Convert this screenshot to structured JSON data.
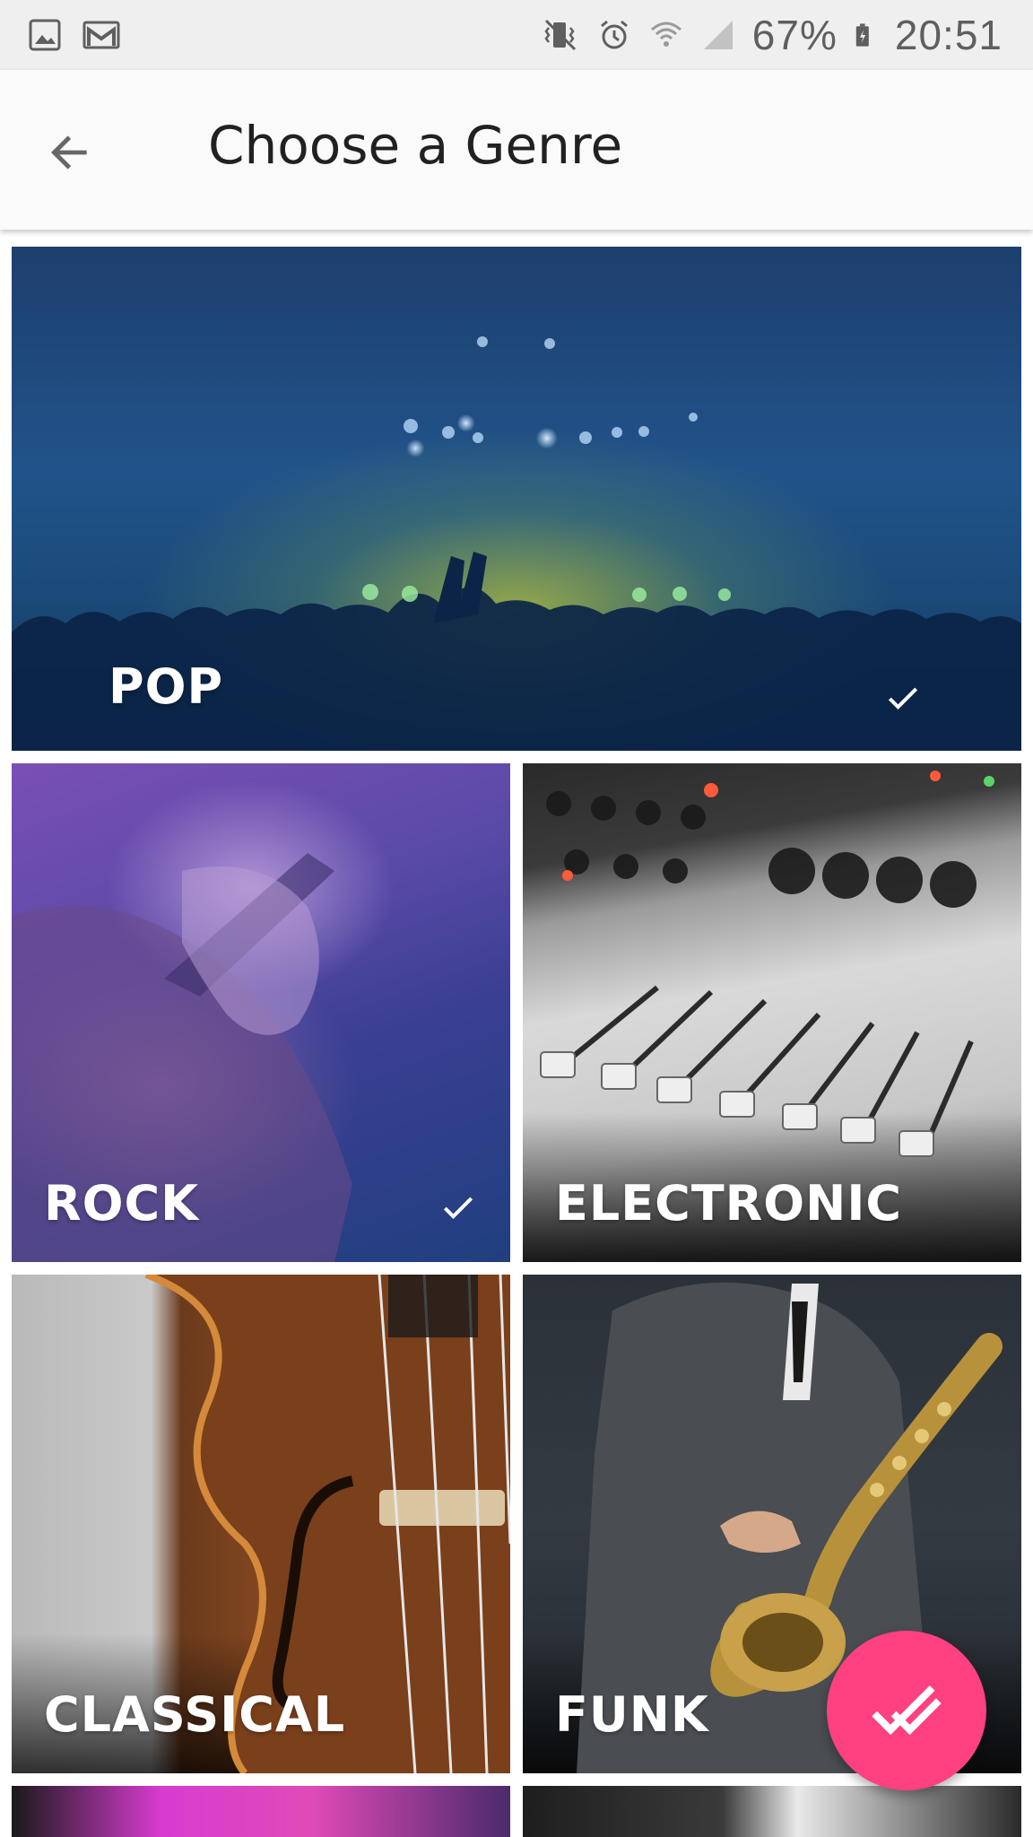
{
  "status_bar": {
    "battery": "67%",
    "time": "20:51",
    "icons_left": [
      "image-icon",
      "gmail-icon"
    ],
    "icons_right": [
      "vibrate-icon",
      "alarm-icon",
      "wifi-icon",
      "signal-icon",
      "battery-icon"
    ]
  },
  "app_bar": {
    "title": "Choose a Genre",
    "back_icon": "arrow-back-icon"
  },
  "genres": [
    {
      "label": "POP",
      "selected": true
    },
    {
      "label": "ROCK",
      "selected": true
    },
    {
      "label": "ELECTRONIC",
      "selected": false
    },
    {
      "label": "CLASSICAL",
      "selected": false
    },
    {
      "label": "FUNK",
      "selected": false
    }
  ],
  "fab": {
    "icon": "done-all-icon"
  },
  "colors": {
    "accent": "#ff4081"
  }
}
